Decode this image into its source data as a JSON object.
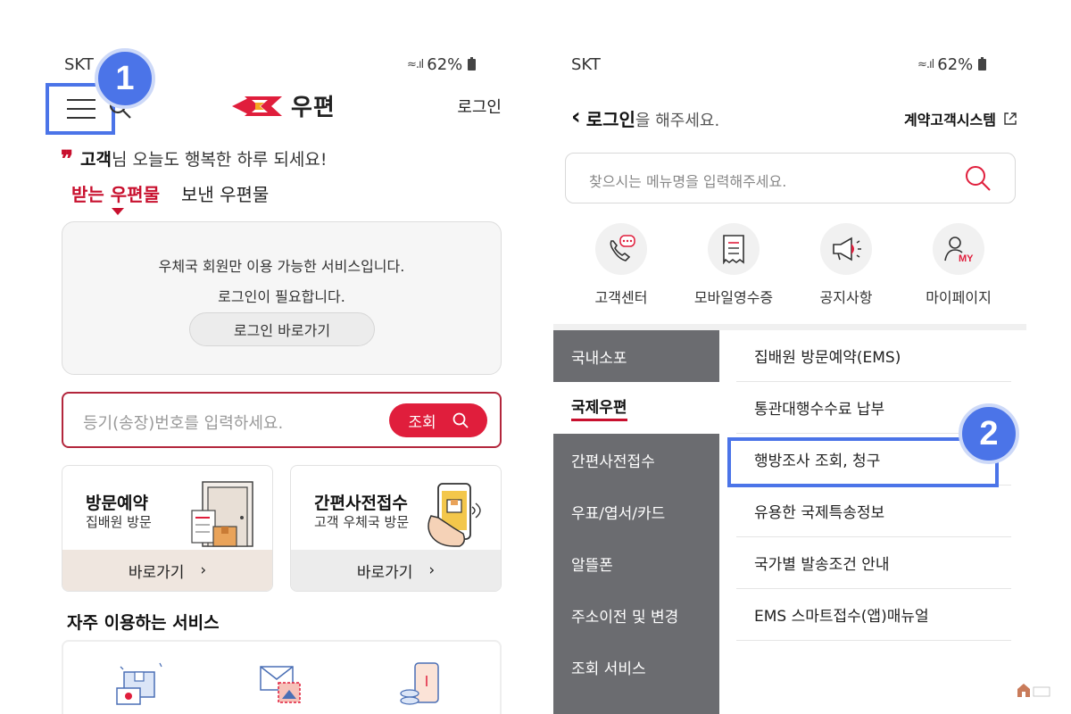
{
  "left": {
    "status": {
      "carrier": "SKT",
      "battery": "62%"
    },
    "header": {
      "logo_text": "우편",
      "login_label": "로그인"
    },
    "step_badge": "1",
    "greeting": {
      "name": "고객",
      "message": "님 오늘도 행복한 하루 되세요!"
    },
    "tabs": [
      {
        "label": "받는 우편물",
        "active": true
      },
      {
        "label": "보낸 우편물",
        "active": false
      }
    ],
    "login_box": {
      "line1": "우체국 회원만 이용 가능한 서비스입니다.",
      "line2": "로그인이 필요합니다.",
      "button": "로그인 바로가기"
    },
    "tracking": {
      "placeholder": "등기(송장)번호를 입력하세요.",
      "button": "조회"
    },
    "cards": [
      {
        "title": "방문예약",
        "subtitle": "집배원 방문",
        "action": "바로가기"
      },
      {
        "title": "간편사전접수",
        "subtitle": "고객 우체국 방문",
        "action": "바로가기"
      }
    ],
    "frequent": {
      "title": "자주 이용하는 서비스"
    }
  },
  "right": {
    "status": {
      "carrier": "SKT",
      "battery": "62%"
    },
    "header": {
      "login_bold": "로그인",
      "login_rest": "을 해주세요.",
      "contract": "계약고객시스템"
    },
    "search": {
      "placeholder": "찾으시는 메뉴명을 입력해주세요."
    },
    "quick": [
      {
        "label": "고객센터",
        "icon": "phone-chat-icon"
      },
      {
        "label": "모바일영수증",
        "icon": "receipt-icon"
      },
      {
        "label": "공지사항",
        "icon": "megaphone-icon"
      },
      {
        "label": "마이페이지",
        "icon": "my-page-icon"
      }
    ],
    "categories": [
      "국내소포",
      "국제우편",
      "간편사전접수",
      "우표/엽서/카드",
      "알뜰폰",
      "주소이전 및 변경",
      "조회 서비스"
    ],
    "active_category": "국제우편",
    "sub_items": [
      "집배원 방문예약(EMS)",
      "통관대행수수료 납부",
      "행방조사 조회, 청구",
      "유용한 국제특송정보",
      "국가별 발송조건 안내",
      "EMS 스마트접수(앱)매뉴얼"
    ],
    "step_badge": "2"
  },
  "colors": {
    "accent_red": "#c8102e",
    "highlight_blue": "#4b74e8",
    "category_gray": "#6b6c70"
  }
}
